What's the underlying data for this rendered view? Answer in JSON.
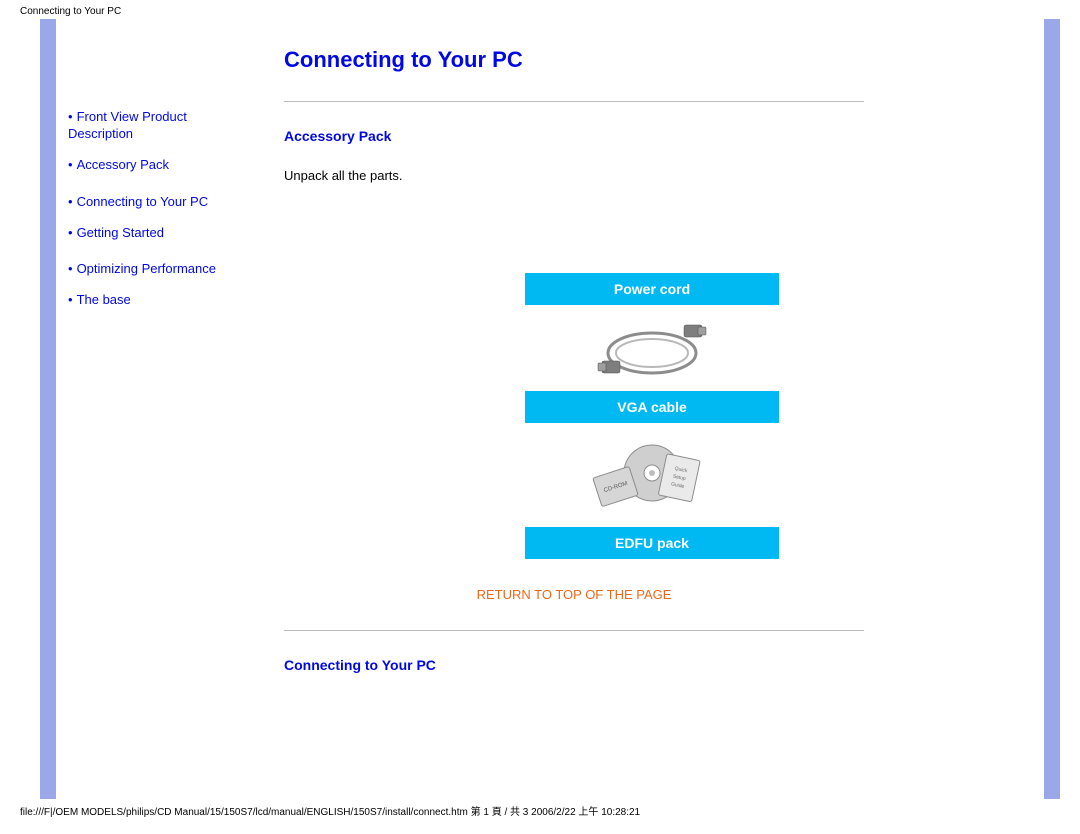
{
  "header_path": "Connecting to Your PC",
  "sidebar": {
    "items": [
      {
        "label": "Front View Product Description"
      },
      {
        "label": "Accessory Pack"
      },
      {
        "label": "Connecting to Your PC"
      },
      {
        "label": "Getting Started"
      },
      {
        "label": "Optimizing Performance"
      },
      {
        "label": "The base"
      }
    ]
  },
  "main": {
    "title": "Connecting to Your PC",
    "accessory_heading": "Accessory Pack",
    "unpack_text": "Unpack all the parts.",
    "labels": {
      "power_cord": "Power cord",
      "vga_cable": "VGA cable",
      "edfu_pack": "EDFU pack"
    },
    "return_link": "RETURN TO TOP OF THE PAGE",
    "connecting_heading": "Connecting to Your PC"
  },
  "footer_path": "file:///F|/OEM MODELS/philips/CD Manual/15/150S7/lcd/manual/ENGLISH/150S7/install/connect.htm 第 1 頁 / 共 3 2006/2/22 上午 10:28:21"
}
